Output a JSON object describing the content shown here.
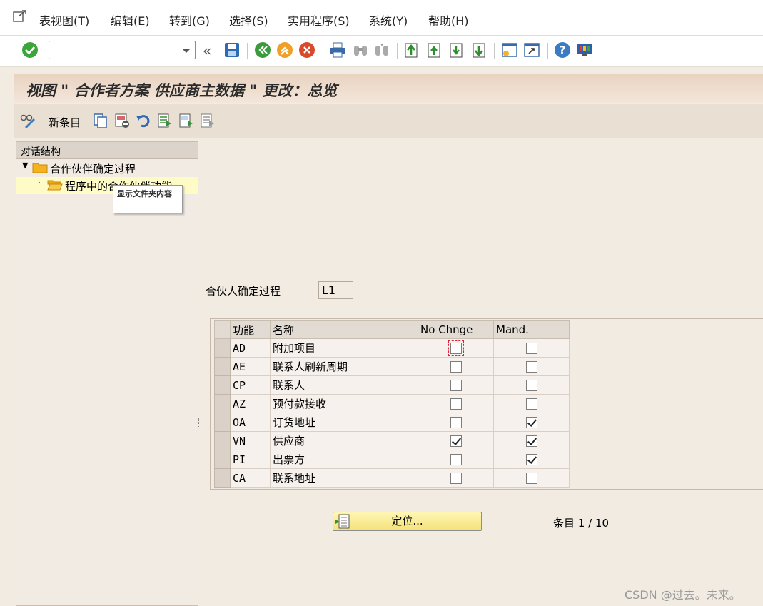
{
  "menubar": {
    "items": [
      "表视图(T)",
      "编辑(E)",
      "转到(G)",
      "选择(S)",
      "实用程序(S)",
      "系统(Y)",
      "帮助(H)"
    ]
  },
  "toolbar": {
    "command_field_value": "",
    "icons": [
      "enter-icon",
      "back-icon",
      "save-icon",
      "back-nav-icon",
      "exit-icon",
      "cancel-icon",
      "print-icon",
      "find-icon",
      "find-next-icon",
      "first-page-icon",
      "prev-page-icon",
      "next-page-icon",
      "last-page-icon",
      "new-session-icon",
      "shortcut-icon",
      "help-icon",
      "layout-icon"
    ]
  },
  "title": "视图 \" 合作者方案 供应商主数据 \" 更改：总览",
  "app_toolbar": {
    "new_entries": "新条目"
  },
  "tree": {
    "header": "对话结构",
    "items": [
      {
        "label": "合作伙伴确定过程",
        "level": 0
      },
      {
        "label": "程序中的合作伙伴功能",
        "level": 1
      }
    ],
    "tooltip": "显示文件夹内容"
  },
  "field": {
    "label": "合伙人确定过程",
    "value": "L1"
  },
  "table": {
    "headers": [
      "功能",
      "名称",
      "No Chnge",
      "Mand."
    ],
    "rows": [
      {
        "code": "AD",
        "name": "附加项目",
        "no_change": false,
        "mand": false
      },
      {
        "code": "AE",
        "name": "联系人刷新周期",
        "no_change": false,
        "mand": false
      },
      {
        "code": "CP",
        "name": "联系人",
        "no_change": false,
        "mand": false
      },
      {
        "code": "AZ",
        "name": "预付款接收",
        "no_change": false,
        "mand": false
      },
      {
        "code": "OA",
        "name": "订货地址",
        "no_change": false,
        "mand": true
      },
      {
        "code": "VN",
        "name": "供应商",
        "no_change": true,
        "mand": true
      },
      {
        "code": "PI",
        "name": "出票方",
        "no_change": false,
        "mand": true
      },
      {
        "code": "CA",
        "name": "联系地址",
        "no_change": false,
        "mand": false
      }
    ]
  },
  "position_button": "定位...",
  "entry_count": "条目 1 / 10",
  "watermark": "CSDN @过去。未来。"
}
